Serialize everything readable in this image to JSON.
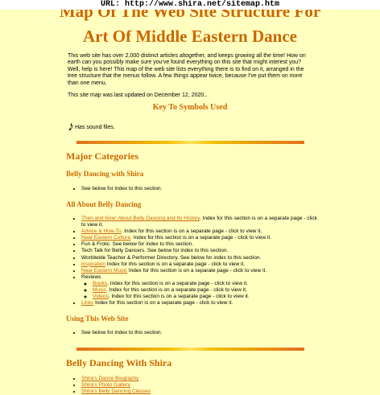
{
  "url_bar": "URL: http://www.shira.net/sitemap.htm",
  "title_line1": "Map Of The Web Site Structure For",
  "title_line2": "Art Of Middle Eastern Dance",
  "intro": {
    "p1": "This web site has over 2,000 distinct articles altogether, and keeps growing all the time! How on earth can you possibly make sure you've found everything on this site that might interest you? Well, help is here! This map of the web site lists everything there is to find on it, arranged in the tree structure that the menus follow. A few things appear twice, because I've put them on more than one menu.",
    "p2": "This site map was last updated on December 12, 2020.."
  },
  "key_heading": "Key To Symbols Used",
  "sound_note": {
    "glyph": "♪",
    "text": "Has sound files."
  },
  "major_heading": "Major Categories",
  "sec_belly_shira": {
    "heading": "Belly Dancing with Shira",
    "items": [
      "See below for index to this section."
    ]
  },
  "sec_about": {
    "heading": "All About Belly Dancing",
    "item1_link": "Then and Now: About Belly Dancing and Its History",
    "item1_text": ". Index for this section is on a separate page - click to view it.",
    "item2_link": "Advice & How-To",
    "item2_text": ". Index for this section is on a separate page - click to view it.",
    "item3_link": "Near Eastern Culture",
    "item3_text": ". Index for this section is on a separate page - click to view it.",
    "item4_text": "Fun & Frolic. See below for index to this section.",
    "item5_text": "Tech Talk for Belly Dancers. See below for index to this section.",
    "item6_text": "Worldwide Teacher & Performer Directory. See below for index to this section.",
    "item7_link": "Inspiration",
    "item7_text": " Index for this section is on a separate page - click to view it.",
    "item8_link": "Near Eastern Music",
    "item8_text": " Index for this section is on a separate page - click to view it.",
    "item9_text": "Reviews",
    "sub1_link": "Books",
    "sub1_text": ". Index for this section is on a separate page - click to view it.",
    "sub2_link": "Music",
    "sub2_text": ". Index for this section is on a separate page - click to view it.",
    "sub3_link": "Videos",
    "sub3_text": ". Index for this section is on a separate page - click to view it.",
    "item10_link": "Links",
    "item10_text": " Index for this section is on a separate page - click to view it."
  },
  "sec_using": {
    "heading": "Using This Web Site",
    "items": [
      "See below for index to this section."
    ]
  },
  "belly_heading": "Belly Dancing With Shira",
  "belly_links": [
    "Shira's Dance Biography",
    "Shira's Photo Gallery",
    "Shira's Belly Dancing Classes"
  ]
}
